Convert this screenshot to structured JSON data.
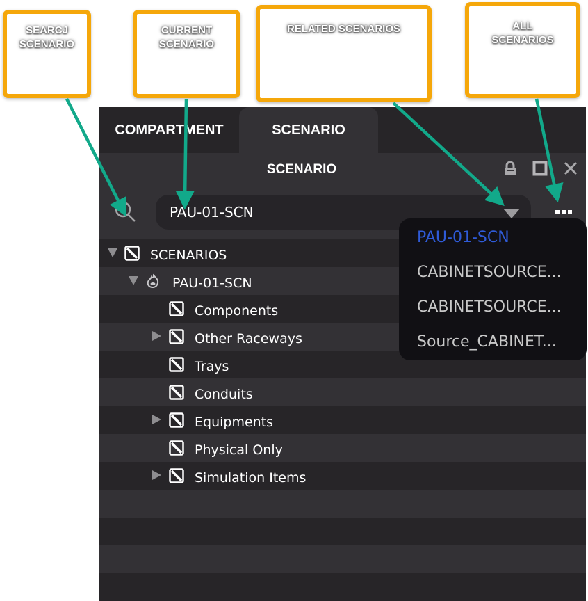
{
  "callouts": [
    {
      "label": "SEARCJ\nSCENARIO"
    },
    {
      "label": "CURRENT\nSCENARIO"
    },
    {
      "label": "RELATED SCENARIOS"
    },
    {
      "label": "ALL\nSCENARIOS"
    }
  ],
  "colors": {
    "callout_border": "#f5a70a",
    "arrow": "#12a98a",
    "panel_bg": "#333135",
    "panel_dark": "#272528",
    "dropdown_bg": "#111014",
    "selected_item": "#2f5bd8"
  },
  "tabs": [
    {
      "label": "COMPARTMENT",
      "active": false
    },
    {
      "label": "SCENARIO",
      "active": true
    }
  ],
  "panel": {
    "title": "SCENARIO",
    "icons": [
      "lock-icon",
      "maximize-icon",
      "close-icon"
    ]
  },
  "search": {
    "icon": "search-icon"
  },
  "current_scenario": {
    "value": "PAU-01-SCN",
    "dropdown_icon": "triangle-down-icon"
  },
  "more_button": {
    "icon": "more-dots-icon"
  },
  "tree": [
    {
      "label": "SCENARIOS",
      "level": 0,
      "expander": "expanded",
      "icon": "visibility-toggle-icon"
    },
    {
      "label": "PAU-01-SCN",
      "level": 1,
      "expander": "expanded",
      "icon": "scenario-flame-icon"
    },
    {
      "label": "Components",
      "level": 2,
      "expander": "none",
      "icon": "visibility-toggle-icon"
    },
    {
      "label": "Other Raceways",
      "level": 2,
      "expander": "collapsed",
      "icon": "visibility-toggle-icon"
    },
    {
      "label": "Trays",
      "level": 2,
      "expander": "none",
      "icon": "visibility-toggle-icon"
    },
    {
      "label": "Conduits",
      "level": 2,
      "expander": "none",
      "icon": "visibility-toggle-icon"
    },
    {
      "label": "Equipments",
      "level": 2,
      "expander": "collapsed",
      "icon": "visibility-toggle-icon"
    },
    {
      "label": "Physical Only",
      "level": 2,
      "expander": "none",
      "icon": "visibility-toggle-icon"
    },
    {
      "label": "Simulation Items",
      "level": 2,
      "expander": "collapsed",
      "icon": "visibility-toggle-icon"
    }
  ],
  "related_scenarios": [
    {
      "label": "PAU-01-SCN",
      "selected": true
    },
    {
      "label": "CABINETSOURCE...",
      "selected": false
    },
    {
      "label": "CABINETSOURCE...",
      "selected": false
    },
    {
      "label": "Source_CABINET...",
      "selected": false
    }
  ]
}
